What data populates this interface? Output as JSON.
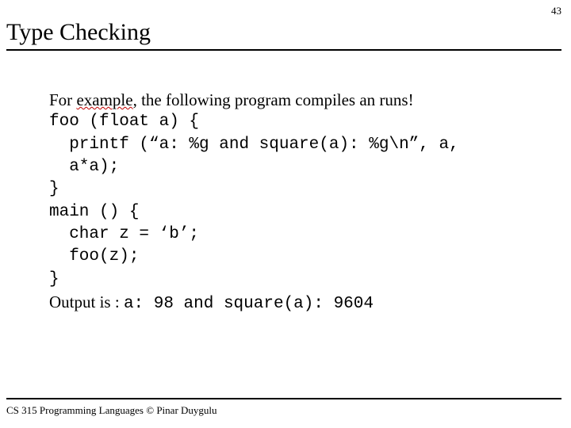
{
  "page_number": "43",
  "title": "Type Checking",
  "body": {
    "intro_prefix": "For ",
    "intro_emph": "example",
    "intro_suffix": ", the following program compiles an runs!",
    "code1": "foo (float a) {",
    "code2": "  printf (“a: %g and square(a): %g\\n”, a,",
    "code3": "  a*a);",
    "code4": "}",
    "code5": "main () {",
    "code6": "  char z = ‘b’;",
    "code7": "  foo(z);",
    "code8": "}",
    "output_label": "Output is : ",
    "output_value": "a: 98 and square(a): 9604"
  },
  "footer": "CS 315 Programming Languages © Pinar Duygulu"
}
